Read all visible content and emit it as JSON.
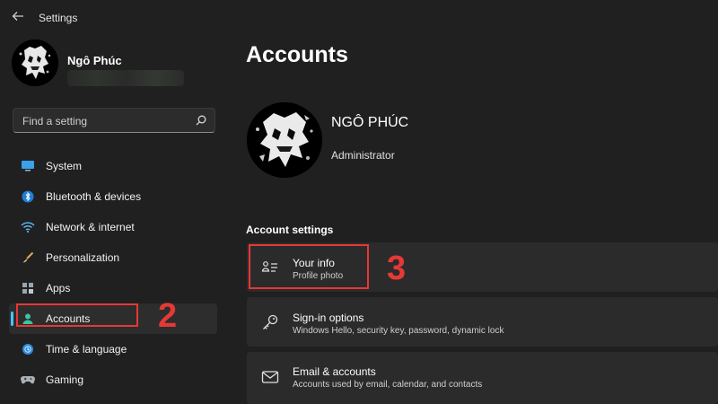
{
  "window": {
    "title": "Settings",
    "back_icon": "back-arrow-icon"
  },
  "profile": {
    "name": "Ngô Phúc"
  },
  "search": {
    "placeholder": "Find a setting",
    "icon": "search-icon"
  },
  "sidebar": {
    "items": [
      {
        "label": "System",
        "icon": "system-icon"
      },
      {
        "label": "Bluetooth & devices",
        "icon": "bluetooth-icon"
      },
      {
        "label": "Network & internet",
        "icon": "wifi-icon"
      },
      {
        "label": "Personalization",
        "icon": "brush-icon"
      },
      {
        "label": "Apps",
        "icon": "apps-icon"
      },
      {
        "label": "Accounts",
        "icon": "person-icon",
        "selected": true
      },
      {
        "label": "Time & language",
        "icon": "globe-icon"
      },
      {
        "label": "Gaming",
        "icon": "gamepad-icon"
      }
    ]
  },
  "annotations": {
    "step2": "2",
    "step3": "3",
    "color": "#e53935"
  },
  "main": {
    "title": "Accounts",
    "account": {
      "name": "NGÔ PHÚC",
      "role": "Administrator"
    },
    "section_title": "Account settings",
    "cards": [
      {
        "title": "Your info",
        "subtitle": "Profile photo",
        "icon": "user-info-icon"
      },
      {
        "title": "Sign-in options",
        "subtitle": "Windows Hello, security key, password, dynamic lock",
        "icon": "key-icon"
      },
      {
        "title": "Email & accounts",
        "subtitle": "Accounts used by email, calendar, and contacts",
        "icon": "mail-icon"
      }
    ]
  },
  "colors": {
    "accent": "#4cc2ff",
    "background": "#202020",
    "card": "#2b2b2b"
  }
}
